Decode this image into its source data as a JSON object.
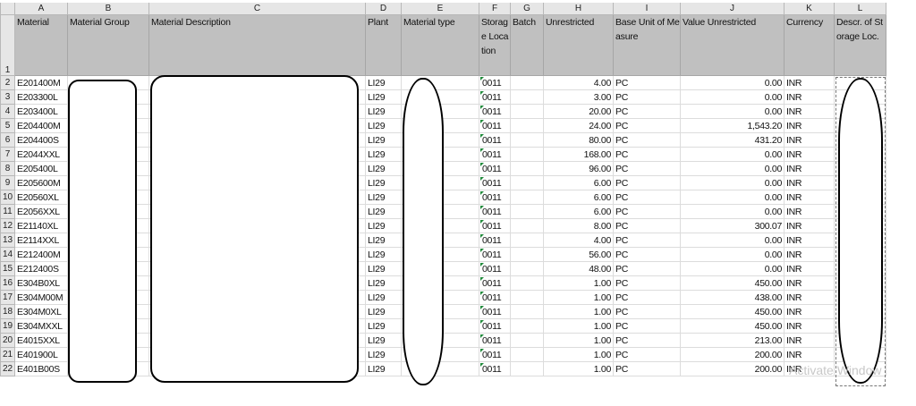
{
  "column_letters": [
    "A",
    "B",
    "C",
    "D",
    "E",
    "F",
    "G",
    "H",
    "I",
    "J",
    "K",
    "L"
  ],
  "header_row_number": "1",
  "headers": {
    "material": "Material",
    "material_group": "Material Group",
    "material_description": "Material Description",
    "plant": "Plant",
    "material_type": "Material type",
    "storage_location": "Storage Location",
    "batch": "Batch",
    "unrestricted": "Unrestricted",
    "base_unit": "Base Unit of Measure",
    "value_unrestricted": "Value Unrestricted",
    "currency": "Currency",
    "storage_loc_descr": "Descr. of Storage Loc."
  },
  "rows": [
    {
      "row": "2",
      "material": "E201400M",
      "plant": "LI29",
      "sloc": "0011",
      "unrestricted": "4.00",
      "unit": "PC",
      "value": "0.00",
      "currency": "INR"
    },
    {
      "row": "3",
      "material": "E203300L",
      "plant": "LI29",
      "sloc": "0011",
      "unrestricted": "3.00",
      "unit": "PC",
      "value": "0.00",
      "currency": "INR"
    },
    {
      "row": "4",
      "material": "E203400L",
      "plant": "LI29",
      "sloc": "0011",
      "unrestricted": "20.00",
      "unit": "PC",
      "value": "0.00",
      "currency": "INR"
    },
    {
      "row": "5",
      "material": "E204400M",
      "plant": "LI29",
      "sloc": "0011",
      "unrestricted": "24.00",
      "unit": "PC",
      "value": "1,543.20",
      "currency": "INR"
    },
    {
      "row": "6",
      "material": "E204400S",
      "plant": "LI29",
      "sloc": "0011",
      "unrestricted": "80.00",
      "unit": "PC",
      "value": "431.20",
      "currency": "INR"
    },
    {
      "row": "7",
      "material": "E2044XXL",
      "plant": "LI29",
      "sloc": "0011",
      "unrestricted": "168.00",
      "unit": "PC",
      "value": "0.00",
      "currency": "INR"
    },
    {
      "row": "8",
      "material": "E205400L",
      "plant": "LI29",
      "sloc": "0011",
      "unrestricted": "96.00",
      "unit": "PC",
      "value": "0.00",
      "currency": "INR"
    },
    {
      "row": "9",
      "material": "E205600M",
      "plant": "LI29",
      "sloc": "0011",
      "unrestricted": "6.00",
      "unit": "PC",
      "value": "0.00",
      "currency": "INR"
    },
    {
      "row": "10",
      "material": "E20560XL",
      "plant": "LI29",
      "sloc": "0011",
      "unrestricted": "6.00",
      "unit": "PC",
      "value": "0.00",
      "currency": "INR"
    },
    {
      "row": "11",
      "material": "E2056XXL",
      "plant": "LI29",
      "sloc": "0011",
      "unrestricted": "6.00",
      "unit": "PC",
      "value": "0.00",
      "currency": "INR"
    },
    {
      "row": "12",
      "material": "E21140XL",
      "plant": "LI29",
      "sloc": "0011",
      "unrestricted": "8.00",
      "unit": "PC",
      "value": "300.07",
      "currency": "INR"
    },
    {
      "row": "13",
      "material": "E2114XXL",
      "plant": "LI29",
      "sloc": "0011",
      "unrestricted": "4.00",
      "unit": "PC",
      "value": "0.00",
      "currency": "INR"
    },
    {
      "row": "14",
      "material": "E212400M",
      "plant": "LI29",
      "sloc": "0011",
      "unrestricted": "56.00",
      "unit": "PC",
      "value": "0.00",
      "currency": "INR"
    },
    {
      "row": "15",
      "material": "E212400S",
      "plant": "LI29",
      "sloc": "0011",
      "unrestricted": "48.00",
      "unit": "PC",
      "value": "0.00",
      "currency": "INR"
    },
    {
      "row": "16",
      "material": "E304B0XL",
      "plant": "LI29",
      "sloc": "0011",
      "unrestricted": "1.00",
      "unit": "PC",
      "value": "450.00",
      "currency": "INR"
    },
    {
      "row": "17",
      "material": "E304M00M",
      "plant": "LI29",
      "sloc": "0011",
      "unrestricted": "1.00",
      "unit": "PC",
      "value": "438.00",
      "currency": "INR"
    },
    {
      "row": "18",
      "material": "E304M0XL",
      "plant": "LI29",
      "sloc": "0011",
      "unrestricted": "1.00",
      "unit": "PC",
      "value": "450.00",
      "currency": "INR"
    },
    {
      "row": "19",
      "material": "E304MXXL",
      "plant": "LI29",
      "sloc": "0011",
      "unrestricted": "1.00",
      "unit": "PC",
      "value": "450.00",
      "currency": "INR"
    },
    {
      "row": "20",
      "material": "E4015XXL",
      "plant": "LI29",
      "sloc": "0011",
      "unrestricted": "1.00",
      "unit": "PC",
      "value": "213.00",
      "currency": "INR"
    },
    {
      "row": "21",
      "material": "E401900L",
      "plant": "LI29",
      "sloc": "0011",
      "unrestricted": "1.00",
      "unit": "PC",
      "value": "200.00",
      "currency": "INR"
    },
    {
      "row": "22",
      "material": "E401B00S",
      "plant": "LI29",
      "sloc": "0011",
      "unrestricted": "1.00",
      "unit": "PC",
      "value": "200.00",
      "currency": "INR"
    }
  ],
  "watermark": "Activate Window"
}
